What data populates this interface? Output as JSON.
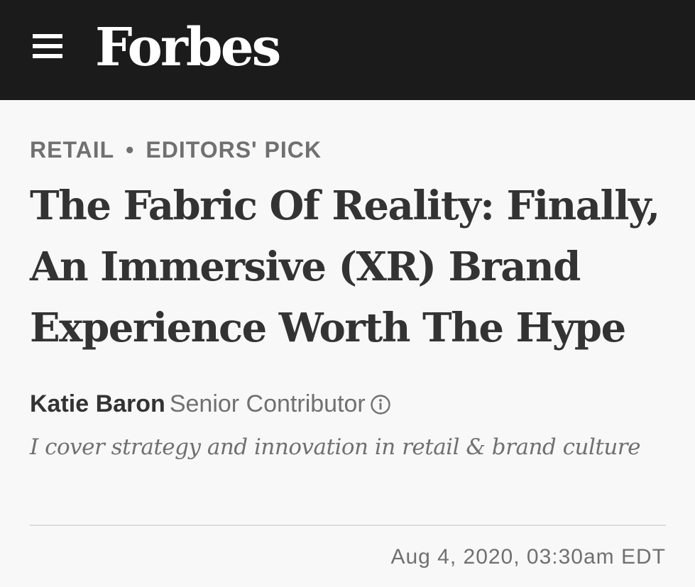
{
  "header": {
    "menu_icon": "hamburger-menu-icon",
    "logo_text": "Forbes"
  },
  "article": {
    "categories": [
      "RETAIL",
      "EDITORS' PICK"
    ],
    "separator": "•",
    "headline": "The Fabric Of Reality: Finally, An Immersive (XR) Brand Experience Worth The Hype",
    "author": {
      "name": "Katie Baron",
      "role": "Senior Contributor",
      "info_icon": "info-circle-icon",
      "bio": "I cover strategy and innovation in retail & brand culture"
    },
    "timestamp": "Aug 4, 2020,  03:30am EDT"
  },
  "colors": {
    "header_bg": "#1b1b1b",
    "page_bg": "#f8f8f8",
    "headline": "#333333",
    "muted": "#707070",
    "divider": "#dcdcdc"
  }
}
